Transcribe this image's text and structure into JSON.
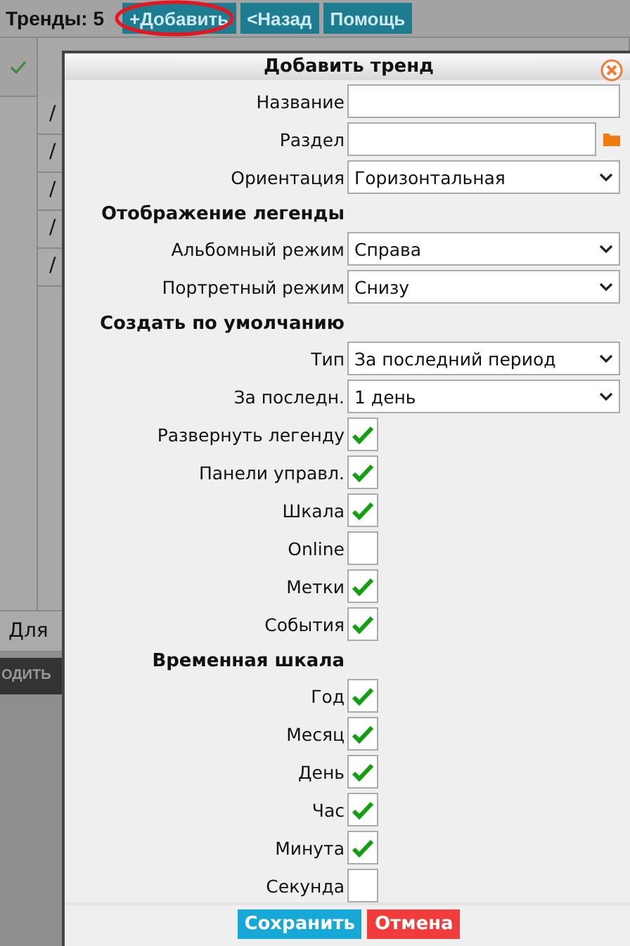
{
  "page": {
    "title": "Тренды: 5",
    "buttons": [
      {
        "label": "+Добавить",
        "highlighted": true
      },
      {
        "label": "<Назад",
        "highlighted": false
      },
      {
        "label": "Помощь",
        "highlighted": false
      }
    ],
    "table": {
      "rows": [
        "/",
        "/",
        "/",
        "/",
        "/"
      ],
      "footer": "Для"
    },
    "bottom_button": "ОДИТЬ"
  },
  "dialog": {
    "title": "Добавить тренд",
    "fields": [
      {
        "kind": "text",
        "label": "Название"
      },
      {
        "kind": "folder",
        "label": "Раздел"
      },
      {
        "kind": "select",
        "label": "Ориентация",
        "value": "Горизонтальная"
      },
      {
        "kind": "heading",
        "label": "Отображение легенды"
      },
      {
        "kind": "select",
        "label": "Альбомный режим",
        "value": "Справа"
      },
      {
        "kind": "select",
        "label": "Портретный режим",
        "value": "Снизу"
      },
      {
        "kind": "heading",
        "label": "Создать по умолчанию"
      },
      {
        "kind": "select",
        "label": "Тип",
        "value": "За последний период"
      },
      {
        "kind": "select",
        "label": "За последн.",
        "value": "1 день"
      },
      {
        "kind": "checkbox",
        "label": "Развернуть легенду",
        "checked": true
      },
      {
        "kind": "checkbox",
        "label": "Панели управл.",
        "checked": true
      },
      {
        "kind": "checkbox",
        "label": "Шкала",
        "checked": true
      },
      {
        "kind": "checkbox",
        "label": "Online",
        "checked": false
      },
      {
        "kind": "checkbox",
        "label": "Метки",
        "checked": true
      },
      {
        "kind": "checkbox",
        "label": "События",
        "checked": true
      },
      {
        "kind": "heading",
        "label": "Временная шкала"
      },
      {
        "kind": "checkbox",
        "label": "Год",
        "checked": true
      },
      {
        "kind": "checkbox",
        "label": "Месяц",
        "checked": true
      },
      {
        "kind": "checkbox",
        "label": "День",
        "checked": true
      },
      {
        "kind": "checkbox",
        "label": "Час",
        "checked": true
      },
      {
        "kind": "checkbox",
        "label": "Минута",
        "checked": true
      },
      {
        "kind": "checkbox",
        "label": "Секунда",
        "checked": false
      }
    ],
    "buttons": [
      {
        "label": "Сохранить",
        "kind": "save"
      },
      {
        "label": "Отмена",
        "kind": "cancel"
      }
    ]
  }
}
